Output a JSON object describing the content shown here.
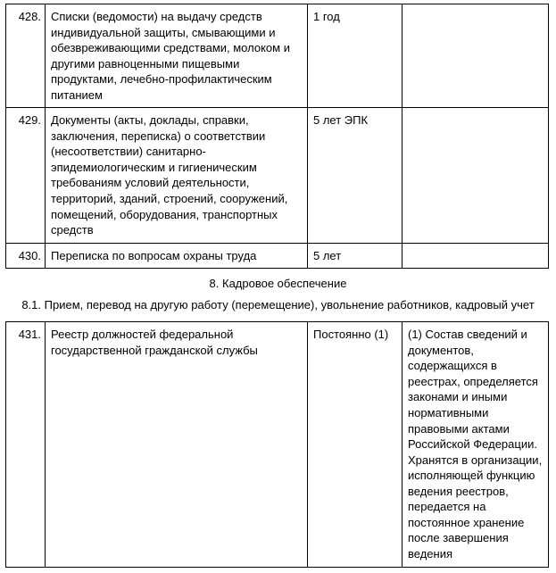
{
  "rows_top": [
    {
      "num": "428.",
      "desc": "Списки (ведомости) на выдачу средств индивидуальной защиты, смывающими и обезвреживающими средствами, молоком и другими равноценными пищевыми продуктами, лечебно-профилактическим питанием",
      "term": "1 год",
      "note": ""
    },
    {
      "num": "429.",
      "desc": "Документы (акты, доклады, справки, заключения, переписка) о соответствии (несоответствии) санитарно-эпидемиологическим и гигиеническим требованиям условий деятельности, территорий, зданий, строений, сооружений, помещений, оборудования, транспортных средств",
      "term": "5 лет ЭПК",
      "note": ""
    },
    {
      "num": "430.",
      "desc": "Переписка по вопросам охраны труда",
      "term": "5 лет",
      "note": ""
    }
  ],
  "section_title": "8. Кадровое обеспечение",
  "subsection_title": "8.1. Прием, перевод на другую работу (перемещение), увольнение работников, кадровый учет",
  "rows_bottom": [
    {
      "num": "431.",
      "desc": "Реестр должностей федеральной государственной гражданской службы",
      "term": "Постоянно (1)",
      "note": "(1) Состав сведений и документов, содержащихся в реестрах, определяется законами и иными нормативными правовыми актами Российской Федерации. Хранятся в организации, исполняющей функцию ведения реестров, передается на постоянное хранение после завершения ведения"
    }
  ]
}
